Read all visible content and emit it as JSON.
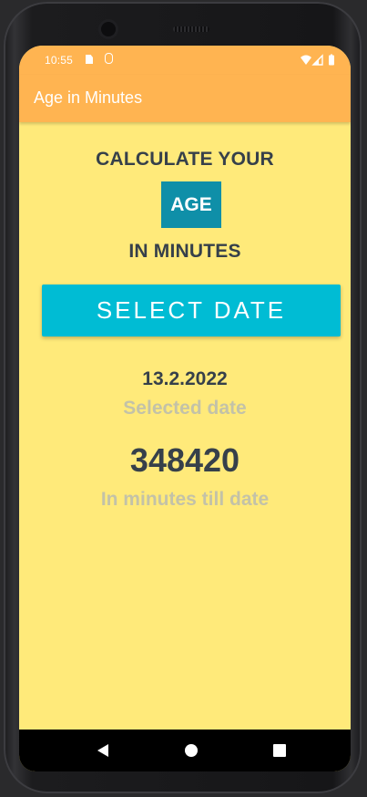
{
  "status_bar": {
    "time": "10:55",
    "icons": [
      "sd-card-icon",
      "b-notification-icon",
      "wifi-icon",
      "signal-icon",
      "battery-icon"
    ]
  },
  "app_bar": {
    "title": "Age in Minutes",
    "color": "#ffb451"
  },
  "content": {
    "heading_line_1": "CALCULATE YOUR",
    "heading_highlight": "AGE",
    "heading_line_2": "IN MINUTES",
    "select_button_label": "SELECT DATE",
    "selected_date": "13.2.2022",
    "selected_date_caption": "Selected date",
    "minutes_value": "348420",
    "minutes_caption": "In minutes till date"
  },
  "colors": {
    "background": "#ffea7a",
    "accent_button": "#00bcd4",
    "highlight_box": "#0f8fa8",
    "text_primary": "#36404a",
    "text_secondary": "#c3c2a8"
  },
  "nav_bar": {
    "icons": [
      "back-icon",
      "home-icon",
      "recents-icon"
    ]
  }
}
